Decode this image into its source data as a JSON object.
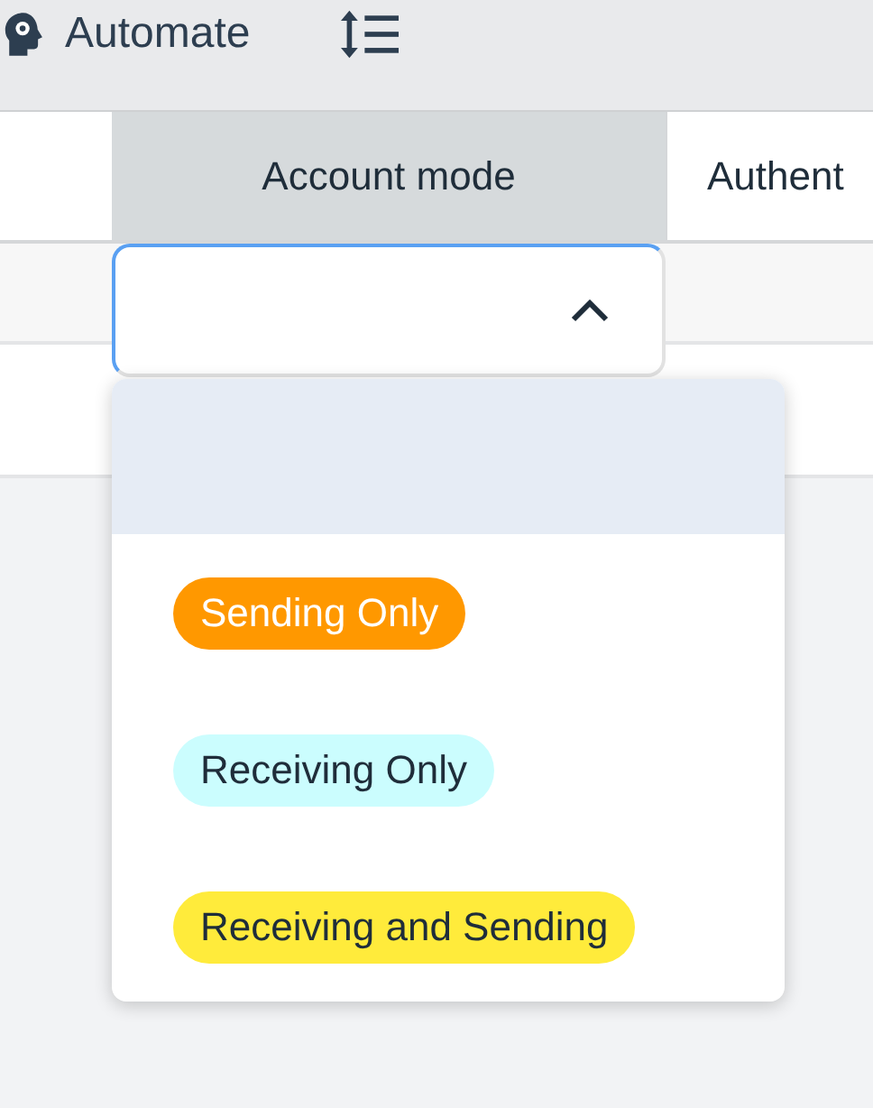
{
  "toolbar": {
    "automate_button": {
      "label": "Automate"
    }
  },
  "table": {
    "columns": [
      {
        "label": "Account mode",
        "highlighted": true
      },
      {
        "label": "Authent",
        "highlighted": false
      }
    ]
  },
  "dropdown": {
    "expanded": true,
    "options": [
      {
        "kind": "blank",
        "highlighted": true
      },
      {
        "kind": "tag",
        "label": "Sending Only",
        "color": "#ff9800",
        "highlighted": false
      },
      {
        "kind": "tag",
        "label": "Receiving Only",
        "color": "#cbfdfe",
        "highlighted": false
      },
      {
        "kind": "tag",
        "label": "Receiving and Sending",
        "color": "#ffeb3b",
        "highlighted": false
      }
    ]
  }
}
